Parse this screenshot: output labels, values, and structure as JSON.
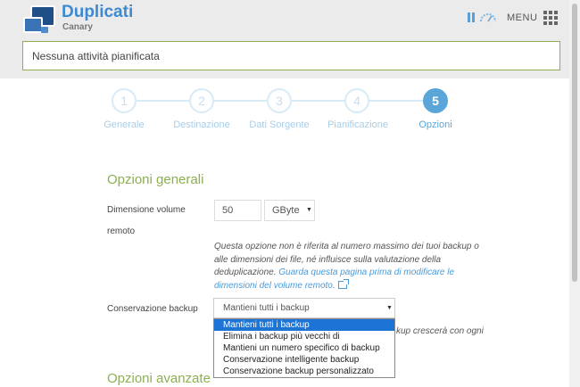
{
  "header": {
    "app_title": "Duplicati",
    "app_subtitle": "Canary",
    "menu_label": "MENU",
    "status_text": "Nessuna attività pianificata"
  },
  "steps": [
    {
      "number": "1",
      "label": "Generale"
    },
    {
      "number": "2",
      "label": "Destinazione"
    },
    {
      "number": "3",
      "label": "Dati Sorgente"
    },
    {
      "number": "4",
      "label": "Pianificazione"
    },
    {
      "number": "5",
      "label": "Opzioni"
    }
  ],
  "active_step": "5",
  "general": {
    "title": "Opzioni generali",
    "volume_label_line1": "Dimensione volume",
    "volume_label_line2": "remoto",
    "volume_value": "50",
    "volume_unit": "GByte",
    "note_text": "Questa opzione non è riferita al numero massimo dei tuoi backup o alle dimensioni dei file, né influisce sulla valutazione della deduplicazione.",
    "note_link": "Guarda questa pagina prima di modificare le dimensioni del volume remoto.",
    "retention_label": "Conservazione backup",
    "retention_value": "Mantieni tutti i backup",
    "retention_options": [
      "Mantieni tutti i backup",
      "Elimina i backup più vecchi di",
      "Mantieni un numero specifico di backup",
      "Conservazione intelligente backup",
      "Conservazione backup personalizzato"
    ],
    "hidden_partial": "kup crescerà con ogni"
  },
  "advanced": {
    "title": "Opzioni avanzate"
  },
  "colors": {
    "accent": "#5aa6d9",
    "section_green": "#8bb050",
    "selected_option": "#1e74d6"
  }
}
